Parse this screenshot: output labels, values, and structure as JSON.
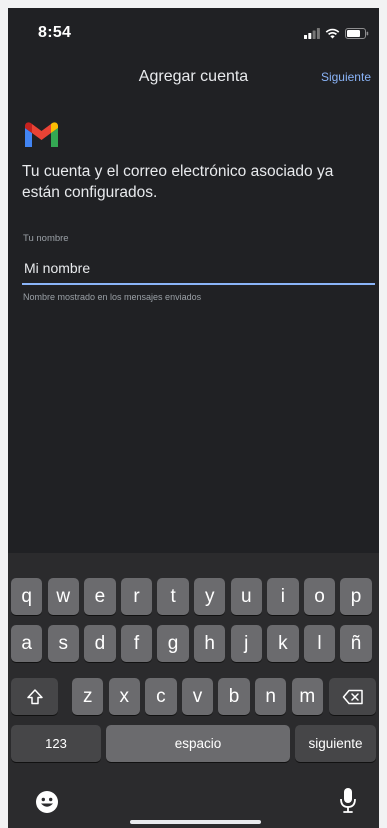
{
  "status_bar": {
    "time": "8:54"
  },
  "header": {
    "title": "Agregar cuenta",
    "next_label": "Siguiente"
  },
  "content": {
    "message": "Tu cuenta y el correo electrónico asociado ya están configurados."
  },
  "form": {
    "name_label": "Tu nombre",
    "name_value": "Mi nombre",
    "name_helper": "Nombre mostrado en los mensajes enviados"
  },
  "keyboard": {
    "row1": [
      "q",
      "w",
      "e",
      "r",
      "t",
      "y",
      "u",
      "i",
      "o",
      "p"
    ],
    "row2": [
      "a",
      "s",
      "d",
      "f",
      "g",
      "h",
      "j",
      "k",
      "l",
      "ñ"
    ],
    "row3": [
      "z",
      "x",
      "c",
      "v",
      "b",
      "n",
      "m"
    ],
    "numbers_label": "123",
    "space_label": "espacio",
    "return_label": "siguiente"
  },
  "colors": {
    "accent": "#8ab4f8",
    "background": "#202124",
    "key": "#6b6b6e",
    "key_dark": "#464648"
  }
}
